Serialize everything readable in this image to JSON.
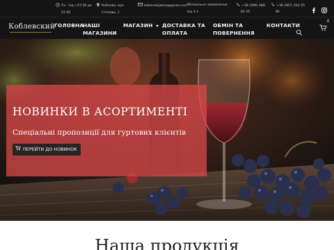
{
  "topbar": {
    "hours": {
      "icon": "clock-icon",
      "line1": "Пн - Нд з 07:30 до",
      "line2": "21:00"
    },
    "address": {
      "icon": "location-pin-icon",
      "line1": "Коблево, вул.",
      "line2": "Степова, 1"
    },
    "email": {
      "icon": "mail-icon",
      "text": "koblevskijwine@gmail.com"
    },
    "min_order": {
      "line1": "Мінімальне замовлення",
      "line2": "від 3 л"
    },
    "phone1": {
      "icon": "phone-icon",
      "line1": "+38 (099) 488",
      "line2": "82 25"
    },
    "phone2": {
      "icon": "phone-icon",
      "line1": "+38 (067) 424 05",
      "line2": "80"
    },
    "social": [
      "facebook-icon",
      "instagram-icon"
    ]
  },
  "nav": {
    "logo": "Коблевский",
    "items": [
      "ГОЛОВНА",
      "НАШІ\nМАГАЗИНИ",
      "МАГАЗИН",
      "ДОСТАВКА ТА\nОПЛАТА",
      "ОБМІН ТА\nПОВЕРНЕННЯ",
      "КОНТАКТИ"
    ],
    "cart_count": "0"
  },
  "hero": {
    "title": "НОВИНКИ В АСОРТИМЕНТІ",
    "subtitle": "Спеціальні пропозиції для гуртових клієнтів",
    "button_label": "ПЕРЕЙТИ ДО НОВИНОК",
    "button_icon": "cart-icon"
  },
  "section": {
    "title": "Наша продукція"
  },
  "colors": {
    "header_bg": "#141414",
    "promo_overlay": "#d44648",
    "button_bg": "#2a2322",
    "logo_accent": "#9b7a4a"
  }
}
